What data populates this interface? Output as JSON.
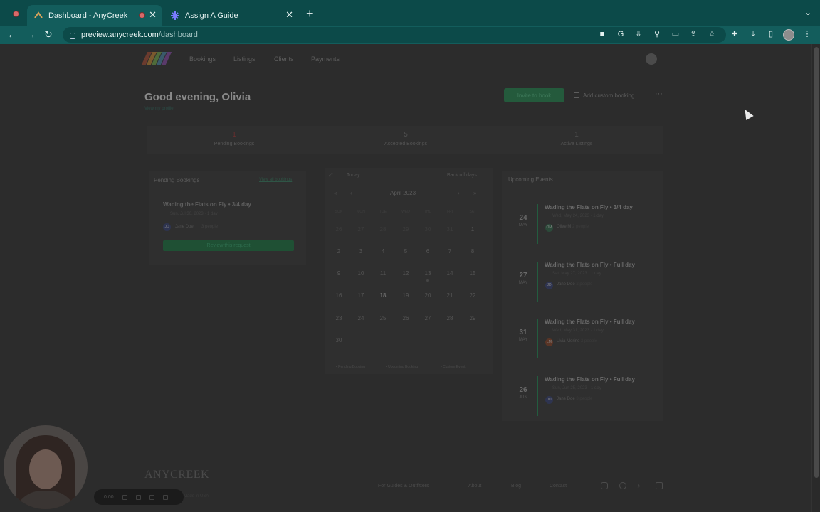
{
  "browser": {
    "tabs": [
      {
        "title": "Dashboard - AnyCreek",
        "active": true
      },
      {
        "title": "Assign A Guide",
        "active": false
      }
    ],
    "url_host": "preview.anycreek.com",
    "url_path": "/dashboard",
    "new_tab_label": "+"
  },
  "nav": {
    "items": [
      "Bookings",
      "Listings",
      "Clients",
      "Payments"
    ]
  },
  "header": {
    "greeting": "Good evening, Olivia",
    "profile_link": "View my profile",
    "invite_label": "Invite to book",
    "custom_booking_label": "Add custom booking",
    "more_label": "···"
  },
  "stats": [
    {
      "value": "1",
      "label": "Pending Bookings"
    },
    {
      "value": "5",
      "label": "Accepted Bookings"
    },
    {
      "value": "1",
      "label": "Active Listings"
    }
  ],
  "pending": {
    "title": "Pending Bookings",
    "view_all": "View all bookings",
    "item": {
      "title": "Wading the Flats on Fly • 3/4 day",
      "meta": "Sun, Jul 30, 2023 · 1 day",
      "client": "Jane Doe",
      "guests": "3 people",
      "initials": "JD",
      "review_label": "Review this request"
    }
  },
  "calendar": {
    "today_label": "Today",
    "back_label": "Back off days",
    "month": "April 2023",
    "prev_year": "«",
    "prev_month": "‹",
    "next_month": "›",
    "next_year": "»",
    "dow": [
      "SUN",
      "MON",
      "TUE",
      "WED",
      "THU",
      "FRI",
      "SAT"
    ],
    "weeks": [
      [
        "26",
        "27",
        "28",
        "29",
        "30",
        "31",
        "1"
      ],
      [
        "2",
        "3",
        "4",
        "5",
        "6",
        "7",
        "8"
      ],
      [
        "9",
        "10",
        "11",
        "12",
        "13",
        "14",
        "15"
      ],
      [
        "16",
        "17",
        "18",
        "19",
        "20",
        "21",
        "22"
      ],
      [
        "23",
        "24",
        "25",
        "26",
        "27",
        "28",
        "29"
      ],
      [
        "30",
        "",
        "",
        "",
        "",
        "",
        ""
      ]
    ],
    "legend": [
      "Pending Booking",
      "Upcoming Booking",
      "Custom Event"
    ]
  },
  "upcoming": {
    "title": "Upcoming Events",
    "events": [
      {
        "day": "24",
        "month": "MAY",
        "title": "Wading the Flats on Fly • 3/4 day",
        "meta": "Wed, May 24, 2023 · 1 day",
        "person": "Olive M",
        "guests": "2 people",
        "initials": "OM"
      },
      {
        "day": "27",
        "month": "MAY",
        "title": "Wading the Flats on Fly • Full day",
        "meta": "Sat, May 27, 2023 · 1 day",
        "person": "Jane Doe",
        "guests": "2 people",
        "initials": "JD"
      },
      {
        "day": "31",
        "month": "MAY",
        "title": "Wading the Flats on Fly • Full day",
        "meta": "Wed, May 31, 2023 · 1 day",
        "person": "Livia Merino",
        "guests": "2 people",
        "initials": "LM"
      },
      {
        "day": "26",
        "month": "JUN",
        "title": "Wading the Flats on Fly • Full day",
        "meta": "Sun, Jun 25, 2023 · 1 day",
        "person": "Jane Doe",
        "guests": "3 people",
        "initials": "JD"
      }
    ]
  },
  "footer": {
    "logo": "ANYCREEK",
    "made_in": "Made in USA",
    "links": [
      "For Guides & Outfitters",
      "About",
      "Blog",
      "Contact"
    ]
  },
  "recorder": {
    "time": "0:00"
  }
}
